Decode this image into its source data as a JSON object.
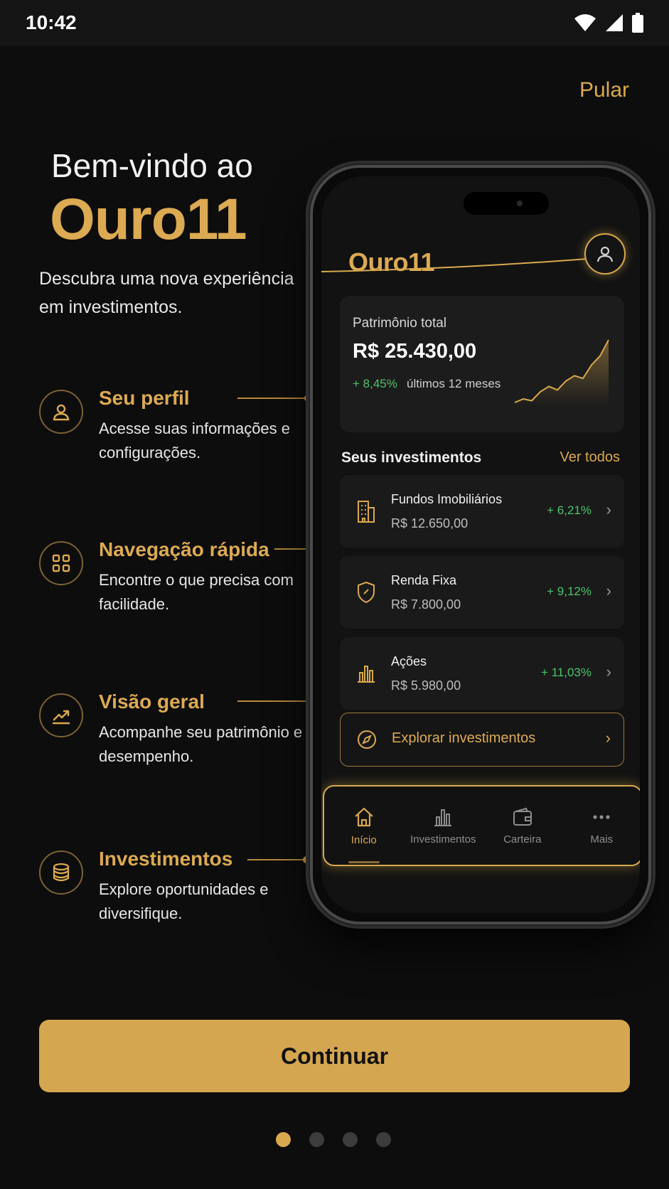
{
  "status_bar": {
    "time": "10:42",
    "icons": [
      "wifi-icon",
      "signal-icon",
      "battery-icon"
    ]
  },
  "header": {
    "skip_label": "Pular"
  },
  "hero": {
    "welcome": "Bem-vindo ao",
    "brand": "Ouro11",
    "description": "Descubra uma nova experiência em investimentos."
  },
  "features": [
    {
      "title": "Seu perfil",
      "description": "Acesse suas informações e configurações.",
      "icon": "user-icon"
    },
    {
      "title": "Navegação rápida",
      "description": "Encontre o que precisa com facilidade.",
      "icon": "grid-icon"
    },
    {
      "title": "Visão geral",
      "description": "Acompanhe seu patrimônio e desempenho.",
      "icon": "trend-up-icon"
    },
    {
      "title": "Investimentos",
      "description": "Explore oportunidades e diversifique.",
      "icon": "coins-icon"
    }
  ],
  "phone": {
    "brand": "Ouro11",
    "total_card": {
      "label": "Patrimônio total",
      "value": "R$ 25.430,00",
      "change": "+ 8,45%",
      "period": "últimos 12 meses",
      "sparkline": [
        10,
        14,
        12,
        22,
        28,
        24,
        34,
        40,
        37,
        52,
        62,
        80
      ]
    },
    "section_title": "Seus investimentos",
    "section_link": "Ver todos",
    "investments": [
      {
        "name": "Fundos Imobiliários",
        "value": "R$ 12.650,00",
        "change": "+ 6,21%",
        "icon": "building-icon"
      },
      {
        "name": "Renda Fixa",
        "value": "R$ 7.800,00",
        "change": "+ 9,12%",
        "icon": "shield-icon"
      },
      {
        "name": "Ações",
        "value": "R$ 5.980,00",
        "change": "+ 11,03%",
        "icon": "bar-chart-icon"
      }
    ],
    "explore_label": "Explorar investimentos",
    "bottom_nav": [
      {
        "label": "Início",
        "icon": "home-icon",
        "active": true
      },
      {
        "label": "Investimentos",
        "icon": "bar-chart-icon",
        "active": false
      },
      {
        "label": "Carteira",
        "icon": "wallet-icon",
        "active": false
      },
      {
        "label": "Mais",
        "icon": "more-icon",
        "active": false
      }
    ]
  },
  "footer": {
    "continue_label": "Continuar",
    "pagination": {
      "total": 4,
      "current": 1
    }
  },
  "colors": {
    "accent": "#d9a94e",
    "background": "#0d0d0d",
    "positive": "#4cc46a"
  }
}
